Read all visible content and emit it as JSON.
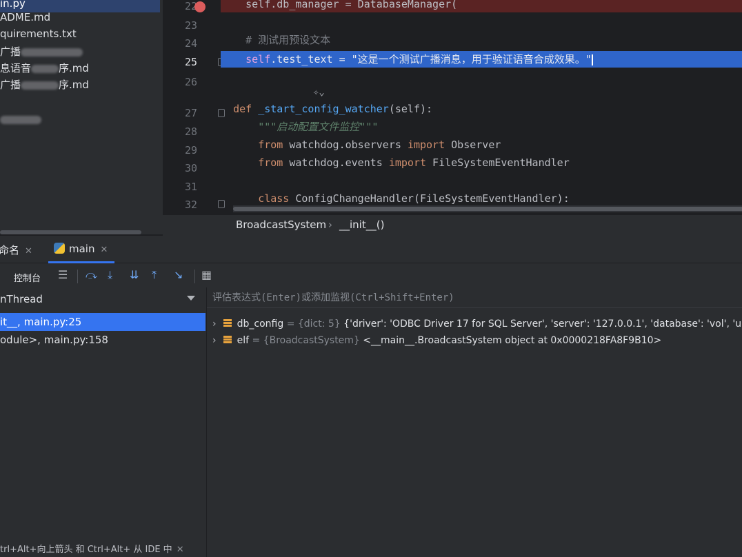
{
  "project": {
    "files": [
      {
        "name": "in.py",
        "selected": true
      },
      {
        "name": "ADME.md"
      },
      {
        "name": "quirements.txt"
      },
      {
        "name": "广播",
        "blurred": true
      },
      {
        "name": "息语音",
        "suffix": "序.md",
        "blurred": true
      },
      {
        "name": "广播",
        "suffix": "序.md",
        "blurred": true
      },
      {
        "name": "",
        "blurred": true
      }
    ]
  },
  "editor": {
    "lines": [
      {
        "num": "22",
        "breakpoint": true
      },
      {
        "num": "23"
      },
      {
        "num": "24"
      },
      {
        "num": "25",
        "active": true
      },
      {
        "num": "26"
      },
      {
        "num": "27"
      },
      {
        "num": "28"
      },
      {
        "num": "29"
      },
      {
        "num": "30"
      },
      {
        "num": "31"
      },
      {
        "num": "32"
      }
    ],
    "code": {
      "l22": "self.db_manager = DatabaseManager(",
      "l24": "# 测试用预设文本",
      "l25_attr": ".test_text = ",
      "l25_self": "self",
      "l25_str": "\"这是一个测试广播消息，用于验证语音合成效果。\"",
      "l27_def": "def",
      "l27_name": "_start_config_watcher",
      "l27_args": "(self):",
      "l28_doc": "\"\"\"启动配置文件监控\"\"\"",
      "l29_from": "from",
      "l29_mod": " watchdog.observers ",
      "l29_import": "import",
      "l29_name": " Observer",
      "l30_from": "from",
      "l30_mod": " watchdog.events ",
      "l30_import": "import",
      "l30_name": " FileSystemEventHandler",
      "l32_class": "class",
      "l32_rest": " ConfigChangeHandler(FileSystemEventHandler):"
    },
    "breadcrumb": {
      "class": "BroadcastSystem",
      "method": "__init__()"
    }
  },
  "debug": {
    "tabs": [
      {
        "label": "命名"
      },
      {
        "label": "main",
        "active": true
      }
    ],
    "console_label": "控制台",
    "thread": "nThread",
    "frames": [
      {
        "label": "it__, main.py:25",
        "active": true
      },
      {
        "label": "odule>, main.py:158"
      }
    ],
    "eval_placeholder": "评估表达式(Enter)或添加监视(Ctrl+Shift+Enter)",
    "variables": [
      {
        "name": "db_config",
        "type": "= {dict: 5}",
        "value": " {'driver': 'ODBC Driver 17 for SQL Server', 'server': '127.0.0.1', 'database': 'vol', 'u"
      },
      {
        "name": "elf",
        "type": "= {BroadcastSystem}",
        "value": " <__main__.BroadcastSystem object at 0x0000218FA8F9B10>"
      }
    ],
    "hint": "trl+Alt+向上箭头 和 Ctrl+Alt+ 从 IDE 中"
  },
  "icons": [
    "python-file-icon",
    "close-icon",
    "list-icon",
    "step-over-icon",
    "step-into-icon",
    "step-into-my-code-icon",
    "step-out-icon",
    "run-to-cursor-icon",
    "table-icon",
    "chevron-down-icon",
    "expand-arrow-icon",
    "variable-icon",
    "breakpoint-icon",
    "fold-icon",
    "bulb-icon"
  ]
}
